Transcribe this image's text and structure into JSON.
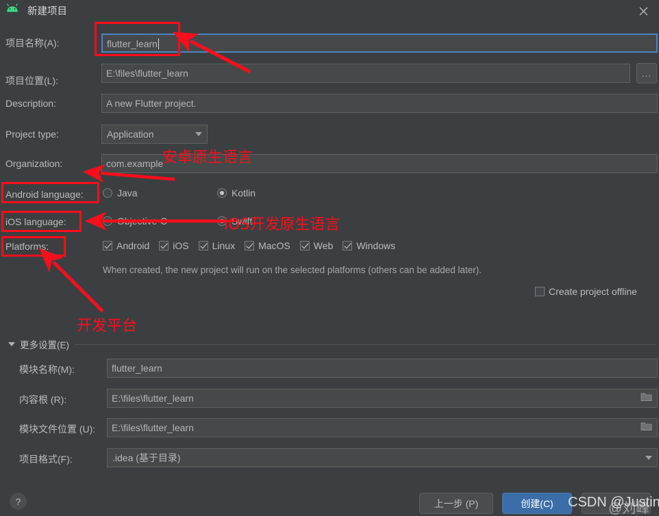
{
  "window": {
    "title": "新建项目",
    "icon": "android-robot-icon",
    "close_label": "✕",
    "bg_color": "#3c3f41",
    "accent_color": "#3b6ea8",
    "annotation_color": "#fc0d1b"
  },
  "form": {
    "project_name": {
      "label": "项目名称(A):",
      "value": "flutter_learn",
      "focused": true
    },
    "project_location": {
      "label": "项目位置(L):",
      "value": "E:\\files\\flutter_learn",
      "browse_label": "..."
    },
    "description": {
      "label": "Description:",
      "value": "A new Flutter project."
    },
    "project_type": {
      "label": "Project type:",
      "value": "Application"
    },
    "organization": {
      "label": "Organization:",
      "value": "com.example"
    },
    "android_language": {
      "label": "Android language:",
      "options": [
        {
          "label": "Java",
          "selected": false
        },
        {
          "label": "Kotlin",
          "selected": true
        }
      ]
    },
    "ios_language": {
      "label": "iOS language:",
      "options": [
        {
          "label": "Objective-C",
          "selected": false
        },
        {
          "label": "Swift",
          "selected": true
        }
      ]
    },
    "platforms": {
      "label": "Platforms:",
      "items": [
        {
          "label": "Android",
          "checked": true
        },
        {
          "label": "iOS",
          "checked": true
        },
        {
          "label": "Linux",
          "checked": true
        },
        {
          "label": "MacOS",
          "checked": true
        },
        {
          "label": "Web",
          "checked": true
        },
        {
          "label": "Windows",
          "checked": true
        }
      ]
    },
    "platform_hint": "When created, the new project will run on the selected platforms (others can be added later).",
    "create_offline": {
      "label": "Create project offline",
      "checked": false
    }
  },
  "more_settings": {
    "header": "更多设置(E)",
    "expanded": true,
    "module_name": {
      "label": "模块名称(M):",
      "value": "flutter_learn"
    },
    "content_root": {
      "label": "内容根 (R):",
      "value": "E:\\files\\flutter_learn"
    },
    "module_file_location": {
      "label": "模块文件位置 (U):",
      "value": "E:\\files\\flutter_learn"
    },
    "project_format": {
      "label": "项目格式(F):",
      "value": ".idea (基于目录)"
    }
  },
  "footer": {
    "help_label": "?",
    "previous_label": "上一步 (P)",
    "create_label": "创建(C)",
    "cancel_label": ""
  },
  "annotations": {
    "android_native_lang": "安卓原生语言",
    "ios_native_lang": "iOS开发原生语言",
    "dev_platform": "开发平台"
  },
  "watermark": {
    "text": "CSDN @Justinc.",
    "secondary": "@刘峰"
  }
}
